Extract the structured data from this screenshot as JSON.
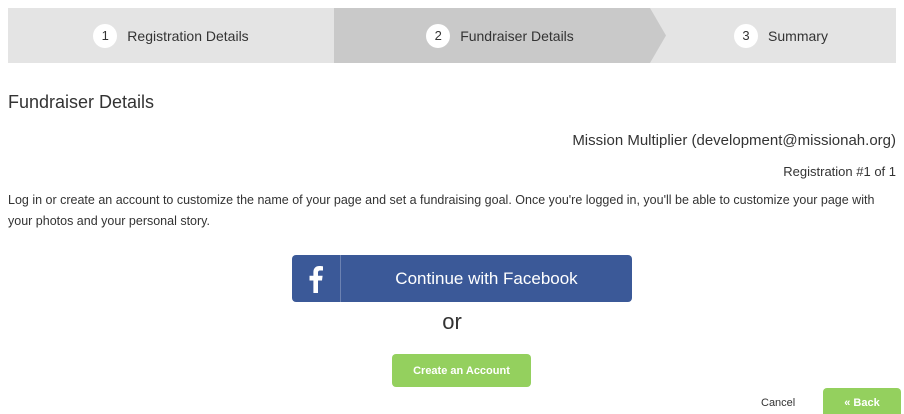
{
  "stepper": {
    "steps": [
      {
        "number": "1",
        "label": "Registration Details"
      },
      {
        "number": "2",
        "label": "Fundraiser Details"
      },
      {
        "number": "3",
        "label": "Summary"
      }
    ]
  },
  "main": {
    "heading": "Fundraiser Details",
    "organization": "Mission Multiplier (development@missionah.org)",
    "registration": "Registration #1 of 1",
    "description": "Log in or create an account to customize the name of your page and set a fundraising goal. Once you're logged in, you'll be able to customize your page with your photos and your personal story.",
    "facebook_button": "Continue with Facebook",
    "facebook_icon": "f",
    "or_text": "or",
    "create_account_button": "Create an Account"
  },
  "footer": {
    "cancel_label": "Cancel",
    "back_label": "« Back"
  },
  "colors": {
    "facebook": "#3b5998",
    "accent_green": "#94d05e",
    "active_step": "#c9c9c9",
    "stepper_bg": "#e4e4e4"
  }
}
